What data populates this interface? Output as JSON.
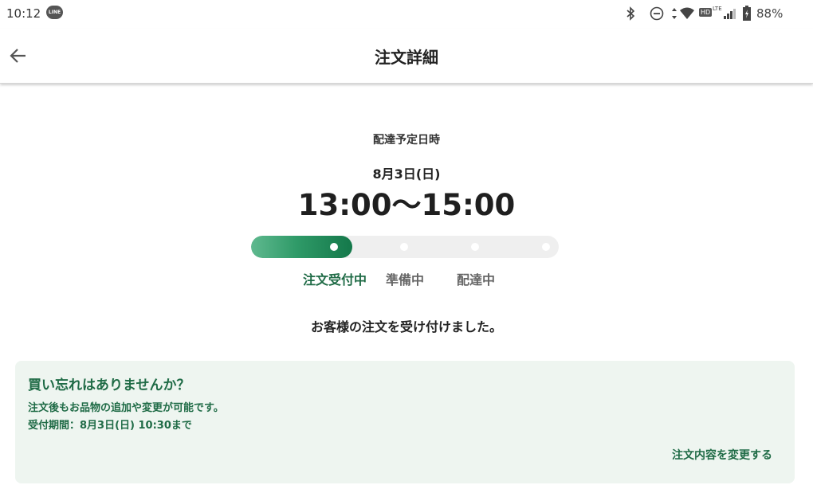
{
  "status_bar": {
    "time": "10:12",
    "line_app": "LINE",
    "battery": "88%",
    "network_hd": "HD",
    "network_lte": "LTE"
  },
  "app_bar": {
    "title": "注文詳細",
    "back_icon": "arrow-left-icon"
  },
  "delivery": {
    "label": "配達予定日時",
    "date": "8月3日(日)",
    "time": "13:00〜15:00"
  },
  "progress": {
    "steps": [
      {
        "label": "注文受付中",
        "active": true
      },
      {
        "label": "準備中",
        "active": false
      },
      {
        "label": "配達中",
        "active": false
      }
    ],
    "completed_fraction": 0.33
  },
  "message": "お客様の注文を受け付けました。",
  "upsell": {
    "title": "買い忘れはありませんか？",
    "body": "注文後もお品物の追加や変更が可能です。",
    "period": "受付期間：8月3日(日) 10:30まで",
    "link": "注文内容を変更する"
  },
  "colors": {
    "accent": "#1f6b46",
    "card_background": "#eef5f0",
    "progress_gradient_start": "#5fb98f",
    "progress_gradient_end": "#14784a",
    "track": "#efefef"
  }
}
